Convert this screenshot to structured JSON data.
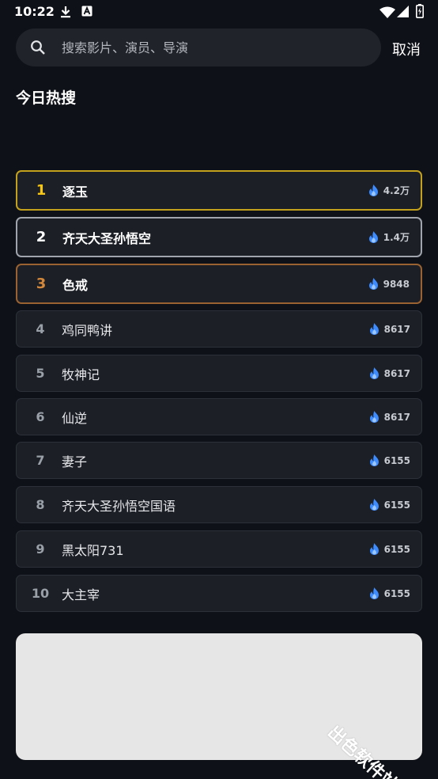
{
  "status_bar": {
    "time": "10:22"
  },
  "search": {
    "placeholder": "搜索影片、演员、导演",
    "value": "",
    "cancel_label": "取消"
  },
  "section": {
    "title": "今日热搜"
  },
  "hot_list": [
    {
      "rank": "1",
      "title": "逐玉",
      "heat": "4.2万"
    },
    {
      "rank": "2",
      "title": "齐天大圣孙悟空",
      "heat": "1.4万"
    },
    {
      "rank": "3",
      "title": "色戒",
      "heat": "9848"
    },
    {
      "rank": "4",
      "title": "鸡同鸭讲",
      "heat": "8617"
    },
    {
      "rank": "5",
      "title": "牧神记",
      "heat": "8617"
    },
    {
      "rank": "6",
      "title": "仙逆",
      "heat": "8617"
    },
    {
      "rank": "7",
      "title": "妻子",
      "heat": "6155"
    },
    {
      "rank": "8",
      "title": "齐天大圣孙悟空国语",
      "heat": "6155"
    },
    {
      "rank": "9",
      "title": "黑太阳731",
      "heat": "6155"
    },
    {
      "rank": "10",
      "title": "大主宰",
      "heat": "6155"
    }
  ],
  "watermark": {
    "text": "出色软件站"
  },
  "colors": {
    "background": "#0e1117",
    "row": "#1c1f26",
    "rank1": "#f5c518",
    "rank2": "#ffffff",
    "rank3": "#d2873a",
    "flame": "#3d8bfd"
  },
  "icons": {
    "status": [
      "download-icon",
      "notification-app-icon",
      "wifi-icon",
      "signal-icon",
      "battery-icon"
    ],
    "search": "search-icon",
    "heat": "flame-icon"
  }
}
